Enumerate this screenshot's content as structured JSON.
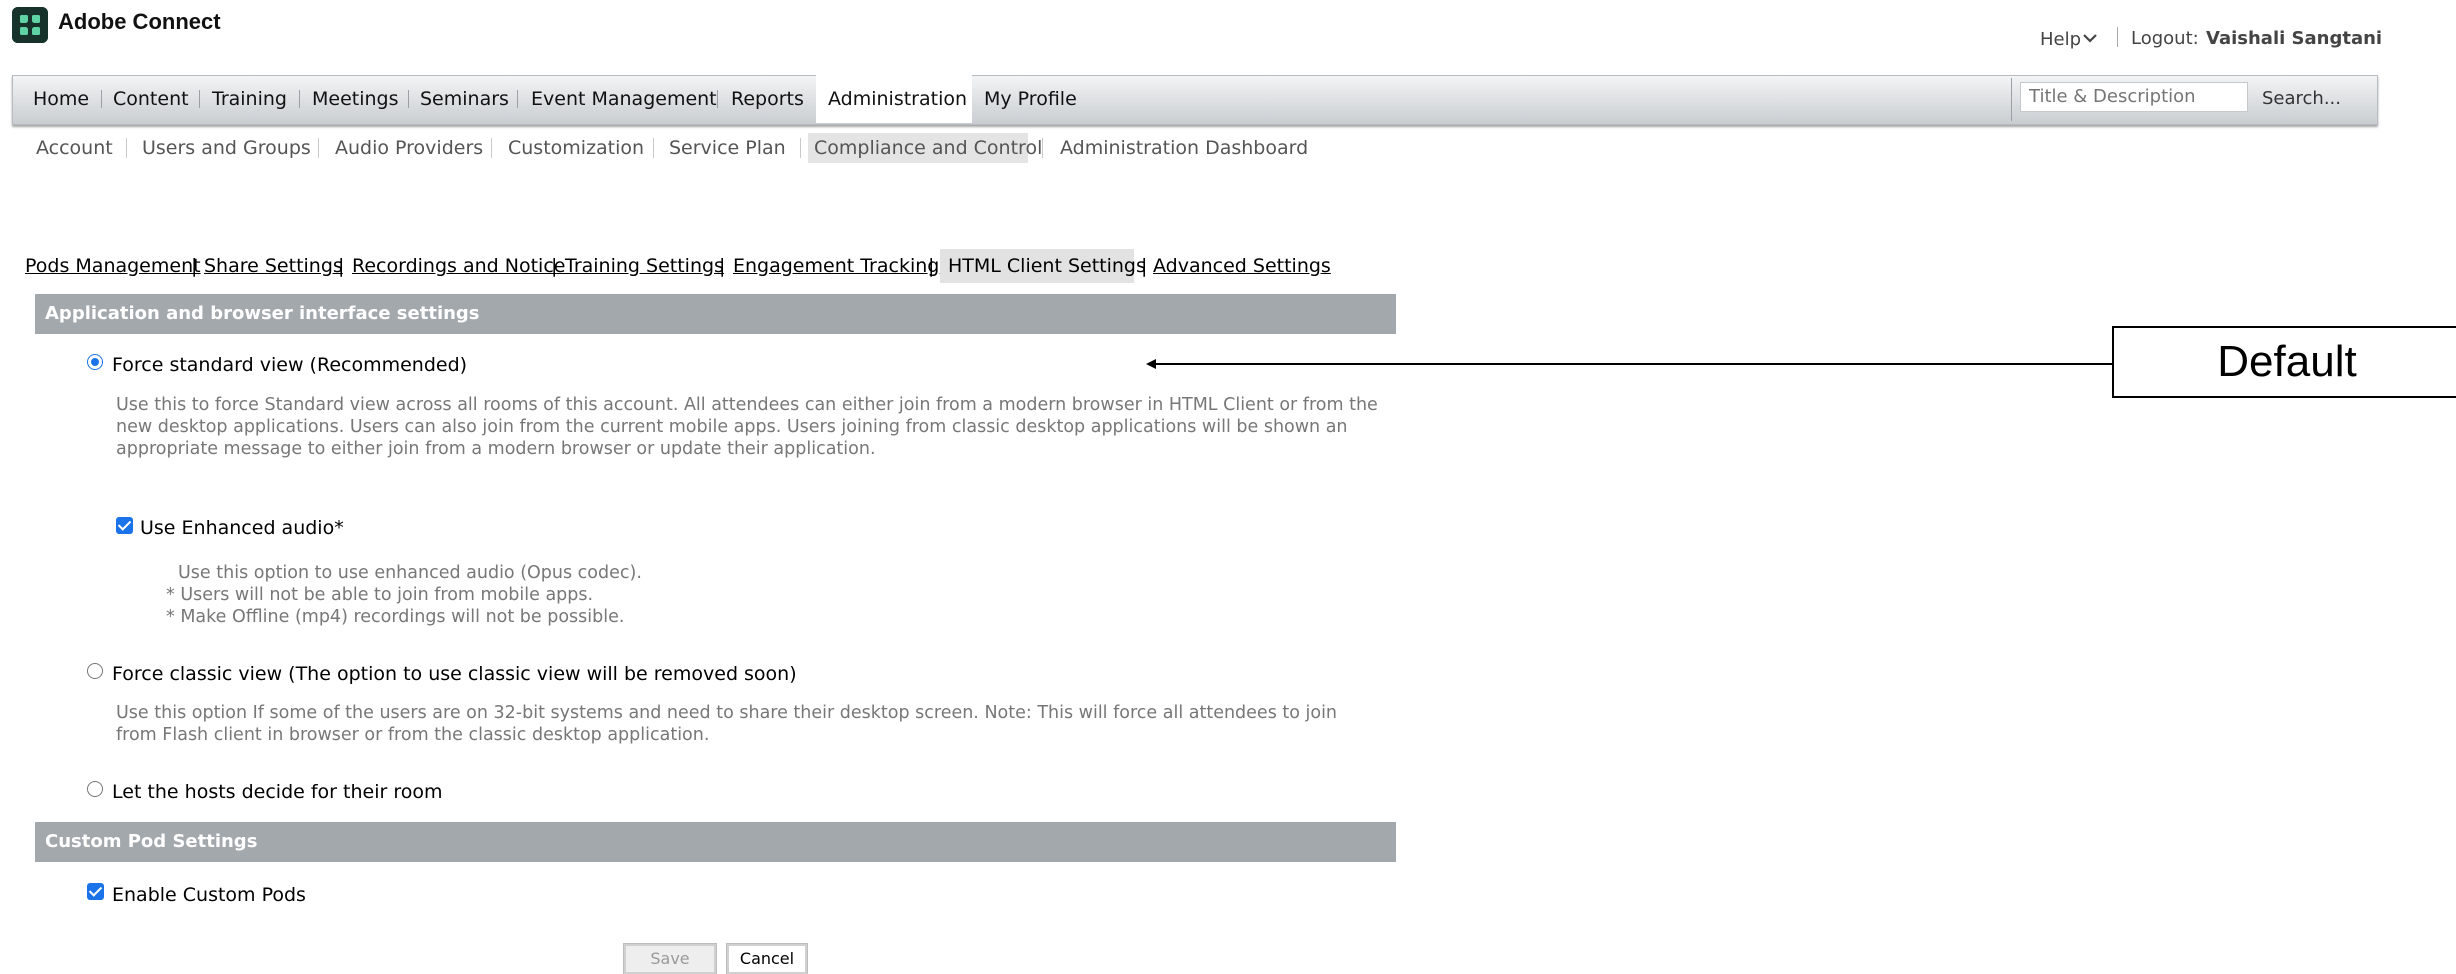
{
  "app": {
    "title": "Adobe Connect",
    "logo_icon": "adobe-connect-logo-icon"
  },
  "header": {
    "help": "Help",
    "logout_label": "Logout:",
    "user": "Vaishali Sangtani"
  },
  "nav": {
    "items": [
      "Home",
      "Content",
      "Training",
      "Meetings",
      "Seminars",
      "Event Management",
      "Reports",
      "Administration",
      "My Profile"
    ],
    "active": "Administration",
    "search_placeholder": "Title & Description",
    "search_button": "Search..."
  },
  "subnav": {
    "items": [
      "Account",
      "Users and Groups",
      "Audio Providers",
      "Customization",
      "Service Plan",
      "Compliance and Control",
      "Administration Dashboard"
    ],
    "active": "Compliance and Control"
  },
  "tabs": {
    "items": [
      "Pods Management",
      "Share Settings",
      "Recordings and Notice",
      "Training Settings",
      "Engagement Tracking",
      "HTML Client Settings",
      "Advanced Settings"
    ],
    "active": "HTML Client Settings"
  },
  "section1": {
    "title": "Application and browser interface settings",
    "opt_standard": {
      "label": "Force standard view (Recommended)",
      "checked": true,
      "desc": [
        "Use this to force Standard view across all rooms of this account. All attendees can either join from a modern browser in HTML Client or from the",
        "new desktop applications. Users can also join from the current mobile apps. Users joining from classic desktop applications will be shown an",
        "appropriate message to either join from a modern browser or update their application."
      ]
    },
    "enhanced_audio": {
      "label": "Use Enhanced audio*",
      "checked": true,
      "desc": [
        "Use this option to use enhanced audio (Opus codec).",
        "* Users will not be able to join from mobile apps.",
        "* Make Offline (mp4) recordings will not be possible."
      ]
    },
    "opt_classic": {
      "label": "Force classic view (The option to use classic view will be removed soon)",
      "checked": false,
      "desc": [
        "Use this option If some of the users are on 32-bit systems and need to share their desktop screen. Note: This will force all attendees to join",
        "from Flash client in browser or from the classic desktop application."
      ]
    },
    "opt_hosts": {
      "label": "Let the hosts decide for their room",
      "checked": false
    }
  },
  "section2": {
    "title": "Custom Pod Settings",
    "enable_pods": {
      "label": "Enable Custom Pods",
      "checked": true
    }
  },
  "buttons": {
    "save": "Save",
    "cancel": "Cancel"
  },
  "annotation": {
    "label": "Default"
  },
  "colors": {
    "accent": "#1a73e8",
    "section_bg": "#a3a8ad",
    "logo_bg": "#16322a"
  }
}
